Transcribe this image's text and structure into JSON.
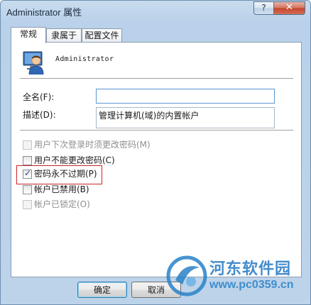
{
  "window": {
    "title": "Administrator 属性",
    "help_label": "?",
    "close_label": "✕"
  },
  "tabs": [
    {
      "label": "常规",
      "active": true
    },
    {
      "label": "隶属于",
      "active": false
    },
    {
      "label": "配置文件",
      "active": false
    }
  ],
  "general": {
    "user_icon": "user-icon",
    "username": "Administrator",
    "full_name_label": "全名(F):",
    "full_name_value": "",
    "description_label": "描述(D):",
    "description_value": "管理计算机(域)的内置帐户",
    "checkboxes": [
      {
        "label": "用户下次登录时须更改密码(M)",
        "checked": false,
        "enabled": false
      },
      {
        "label": "用户不能更改密码(C)",
        "checked": false,
        "enabled": true
      },
      {
        "label": "密码永不过期(P)",
        "checked": true,
        "enabled": true
      },
      {
        "label": "帐户已禁用(B)",
        "checked": false,
        "enabled": true
      },
      {
        "label": "帐户已锁定(O)",
        "checked": false,
        "enabled": false
      }
    ]
  },
  "buttons": {
    "ok_label": "确定",
    "cancel_label": "取消"
  },
  "watermark": {
    "logo_icon": "site-logo-icon",
    "name": "河东软件园",
    "url": "www.pc0359.cn"
  },
  "colors": {
    "highlight": "#c8262b",
    "title_bar": "#b9d1ea",
    "watermark": "#2478c4"
  }
}
